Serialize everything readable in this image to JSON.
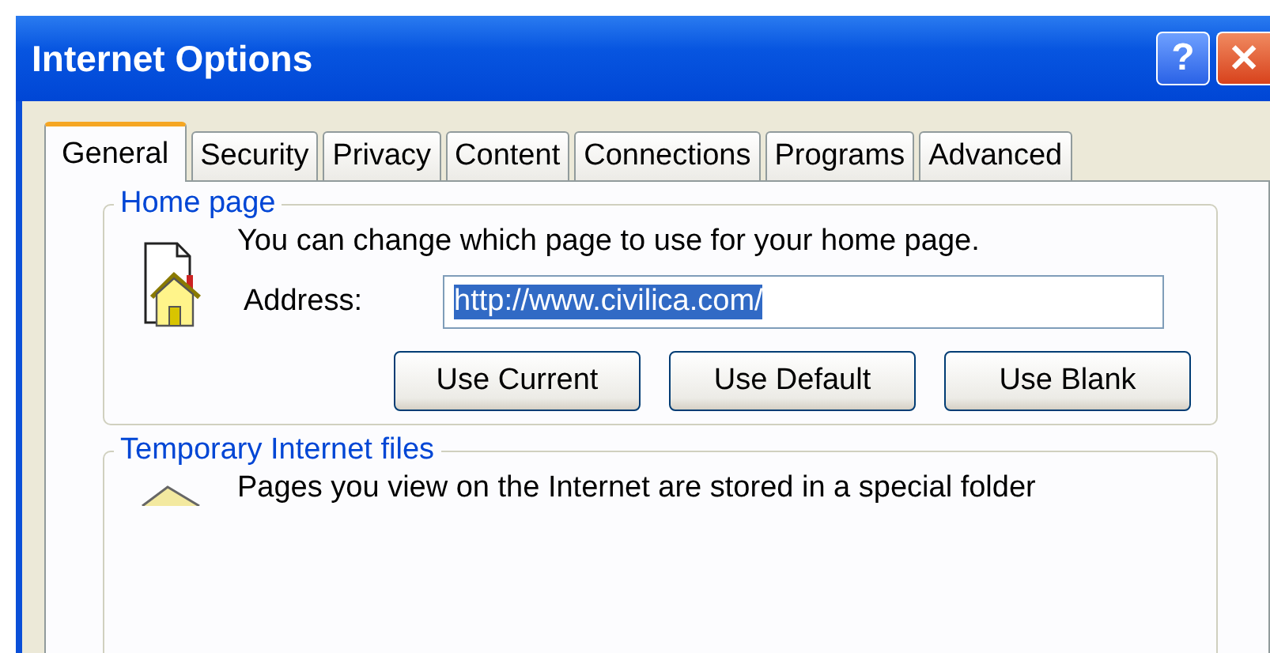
{
  "window": {
    "title": "Internet Options"
  },
  "title_buttons": [
    {
      "kind": "help",
      "label": "?"
    },
    {
      "kind": "close",
      "label": "✕"
    }
  ],
  "tabs": [
    {
      "label": "General",
      "selected": true
    },
    {
      "label": "Security",
      "selected": false
    },
    {
      "label": "Privacy",
      "selected": false
    },
    {
      "label": "Content",
      "selected": false
    },
    {
      "label": "Connections",
      "selected": false
    },
    {
      "label": "Programs",
      "selected": false
    },
    {
      "label": "Advanced",
      "selected": false
    }
  ],
  "home_page": {
    "legend": "Home page",
    "description": "You can change which page to use for your home page.",
    "address_label": "Address:",
    "address": {
      "value": "http://www.civilica.com/",
      "selected": true
    },
    "buttons": [
      "Use Current",
      "Use Default",
      "Use Blank"
    ]
  },
  "temporary_files": {
    "legend": "Temporary Internet files",
    "description": "Pages you view on the Internet are stored in a special folder"
  }
}
